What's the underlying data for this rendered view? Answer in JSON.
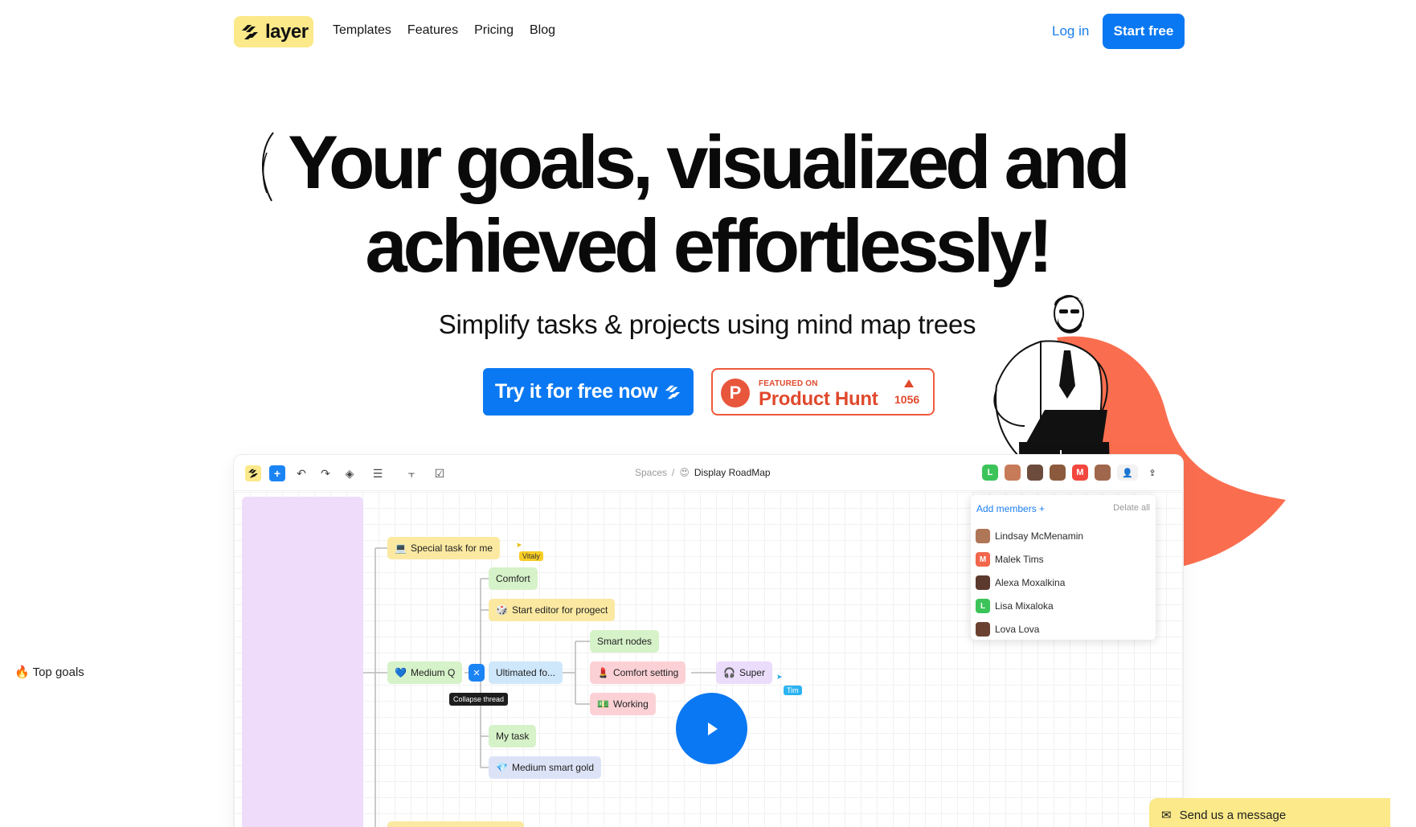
{
  "nav": {
    "logo_text": "layer",
    "links": [
      "Templates",
      "Features",
      "Pricing",
      "Blog"
    ],
    "login": "Log in",
    "start_free": "Start free"
  },
  "hero": {
    "title_line1": "Your goals, visualized and",
    "title_line2": "achieved effortlessly!",
    "subtitle": "Simplify tasks & projects using mind map trees",
    "cta": "Try it for free now",
    "ph_featured": "FEATURED ON",
    "ph_name": "Product Hunt",
    "ph_count": "1056"
  },
  "app": {
    "crumbs_space": "Spaces",
    "crumbs_separator": "/",
    "crumbs_board": "Display RoadMap",
    "column_label": "Top goals",
    "nodes": {
      "special": "Special task for me",
      "comfort": "Comfort",
      "start_editor": "Start editor for progect",
      "medium_q": "Medium Q",
      "ultimated": "Ultimated fo...",
      "smart_nodes": "Smart nodes",
      "comfort_setting": "Comfort setting",
      "super": "Super",
      "working": "Working",
      "my_task": "My task",
      "medium_gold": "Medium smart gold"
    },
    "collapse_tooltip": "Collapse thread",
    "cursor_vitaly": "Vitaly",
    "cursor_tim": "Tim",
    "members": {
      "add": "Add members",
      "delete_all": "Delate all",
      "list": [
        "Lindsay McMenamin",
        "Malek Tims",
        "Alexa Moxalkina",
        "Lisa Mixaloka",
        "Lova Lova"
      ]
    }
  },
  "message": "Send us a message",
  "colors": {
    "brand_blue": "#0a78f2",
    "logo_yellow": "#fbe98a",
    "producthunt": "#e0492d",
    "cape": "#fa6e4f"
  }
}
